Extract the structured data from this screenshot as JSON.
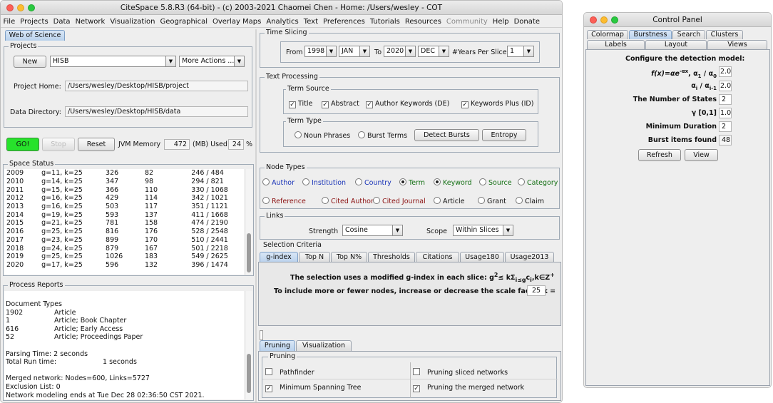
{
  "main": {
    "title": "CiteSpace 5.8.R3 (64-bit) - (c) 2003-2021 Chaomei Chen - Home: /Users/wesley - COT",
    "menu": [
      "File",
      "Projects",
      "Data",
      "Network",
      "Visualization",
      "Geographical",
      "Overlay Maps",
      "Analytics",
      "Text",
      "Preferences",
      "Tutorials",
      "Resources",
      "Community",
      "Help",
      "Donate"
    ],
    "tab_wos": "Web of Science",
    "projects": {
      "title": "Projects",
      "new_label": "New",
      "project_name": "HISB",
      "more_actions": "More Actions ...",
      "home_label": "Project Home:",
      "home_value": "/Users/wesley/Desktop/HISB/project",
      "data_label": "Data Directory:",
      "data_value": "/Users/wesley/Desktop/HISB/data"
    },
    "run": {
      "go": "GO!",
      "stop": "Stop",
      "reset": "Reset",
      "jvm_label": "JVM Memory",
      "jvm_value": "472",
      "used_label": "(MB) Used",
      "used_value": "24",
      "pct": "%"
    },
    "space_status": {
      "title": "Space Status",
      "rows": [
        [
          "2009",
          "g=11, k=25",
          "326",
          "82",
          "246 / 484"
        ],
        [
          "2010",
          "g=14, k=25",
          "347",
          "98",
          "294 / 821"
        ],
        [
          "2011",
          "g=15, k=25",
          "366",
          "110",
          "330 / 1068"
        ],
        [
          "2012",
          "g=16, k=25",
          "429",
          "114",
          "342 / 1021"
        ],
        [
          "2013",
          "g=16, k=25",
          "503",
          "117",
          "351 / 1121"
        ],
        [
          "2014",
          "g=19, k=25",
          "593",
          "137",
          "411 / 1668"
        ],
        [
          "2015",
          "g=21, k=25",
          "781",
          "158",
          "474 / 2190"
        ],
        [
          "2016",
          "g=25, k=25",
          "816",
          "176",
          "528 / 2548"
        ],
        [
          "2017",
          "g=23, k=25",
          "899",
          "170",
          "510 / 2441"
        ],
        [
          "2018",
          "g=24, k=25",
          "879",
          "167",
          "501 / 2218"
        ],
        [
          "2019",
          "g=25, k=25",
          "1026",
          "183",
          "549 / 2625"
        ],
        [
          "2020",
          "g=17, k=25",
          "596",
          "132",
          "396 / 1474"
        ]
      ]
    },
    "process": {
      "title": "Process Reports",
      "doc_types": "Document Types",
      "rows": [
        [
          "1902",
          "Article"
        ],
        [
          "1",
          "Article; Book Chapter"
        ],
        [
          "616",
          "Article; Early Access"
        ],
        [
          "52",
          "Article; Proceedings Paper"
        ]
      ],
      "parsing": "Parsing Time:  2 seconds",
      "total_label": "Total Run time:",
      "total_value": "1 seconds",
      "merged": "Merged network: Nodes=600, Links=5727",
      "exclusion": "Exclusion List: 0",
      "modeling": "Network modeling ends at Tue Dec 28 02:36:50 CST 2021."
    },
    "time_slicing": {
      "title": "Time Slicing",
      "from": "From",
      "from_year": "1998",
      "from_month": "JAN",
      "to": "To",
      "to_year": "2020",
      "to_month": "DEC",
      "years_per_slice_label": "#Years Per Slice",
      "years_per_slice": "1"
    },
    "text_processing": {
      "title": "Text Processing",
      "term_source": "Term Source",
      "sources": [
        {
          "label": "Title",
          "checked": true
        },
        {
          "label": "Abstract",
          "checked": true
        },
        {
          "label": "Author Keywords (DE)",
          "checked": true
        },
        {
          "label": "Keywords Plus (ID)",
          "checked": true
        }
      ],
      "term_type": "Term Type",
      "noun": "Noun Phrases",
      "burst_terms": "Burst Terms",
      "detect_bursts": "Detect Bursts",
      "entropy": "Entropy"
    },
    "node_types": {
      "title": "Node Types",
      "row1": [
        {
          "label": "Author",
          "color": "#1a34b8",
          "on": false
        },
        {
          "label": "Institution",
          "color": "#1a34b8",
          "on": false
        },
        {
          "label": "Country",
          "color": "#1a34b8",
          "on": false
        },
        {
          "label": "Term",
          "color": "#147014",
          "on": true
        },
        {
          "label": "Keyword",
          "color": "#147014",
          "on": true
        },
        {
          "label": "Source",
          "color": "#147014",
          "on": false
        },
        {
          "label": "Category",
          "color": "#147014",
          "on": false
        }
      ],
      "row2": [
        {
          "label": "Reference",
          "color": "#8b1111",
          "on": false
        },
        {
          "label": "Cited Author",
          "color": "#8b1111",
          "on": false
        },
        {
          "label": "Cited Journal",
          "color": "#8b1111",
          "on": false
        },
        {
          "label": "Article",
          "color": "#111111",
          "on": false
        },
        {
          "label": "Grant",
          "color": "#111111",
          "on": false
        },
        {
          "label": "Claim",
          "color": "#111111",
          "on": false
        }
      ]
    },
    "links": {
      "title": "Links",
      "strength_label": "Strength",
      "strength": "Cosine",
      "scope_label": "Scope",
      "scope": "Within Slices"
    },
    "selection": {
      "title": "Selection Criteria",
      "tabs": [
        "g-index",
        "Top N",
        "Top N%",
        "Thresholds",
        "Citations",
        "Usage180",
        "Usage2013"
      ],
      "line1_pre": "The selection uses a modified g-index in each slice: g",
      "line1_sup": "2",
      "line1_mid": "≤ kΣ",
      "line1_sub": "i≤g",
      "line1_post": "c",
      "line1_sub2": "i",
      "line1_end": ",k∈Z",
      "line1_sup2": "+",
      "line2": "To include more or fewer nodes, increase or decrease the scale factor k =",
      "k": "25"
    },
    "pruning": {
      "tabs": [
        "Pruning",
        "Visualization"
      ],
      "title": "Pruning",
      "items": [
        {
          "label": "Pathfinder",
          "checked": false
        },
        {
          "label": "Pruning sliced networks",
          "checked": false
        },
        {
          "label": "Minimum Spanning Tree",
          "checked": true
        },
        {
          "label": "Pruning the merged network",
          "checked": true
        }
      ]
    }
  },
  "control": {
    "title": "Control Panel",
    "tabs_row1": [
      "Colormap",
      "Burstness",
      "Search",
      "Clusters"
    ],
    "tabs_row2": [
      "Labels",
      "Layout",
      "Views"
    ],
    "configure": "Configure the detection model:",
    "f_label": "f(x)=αe",
    "f_sup": "-αx",
    "f_mid": ", α",
    "f_sub1": "1",
    "f_slash": " / α",
    "f_sub0": "0",
    "f_value": "2.0",
    "a_label": "α",
    "a_sub": "i",
    "a_slash": " / α",
    "a_sub2": "i-1",
    "a_value": "2.0",
    "states_label": "The Number of States",
    "states_value": "2",
    "gamma_label": "γ [0,1]",
    "gamma_value": "1.0",
    "mindur_label": "Minimum Duration",
    "mindur_value": "2",
    "found_label": "Burst items found",
    "found_value": "48",
    "refresh": "Refresh",
    "view": "View"
  }
}
